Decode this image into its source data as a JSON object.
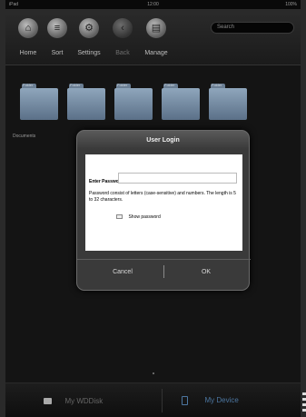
{
  "status_bar": {
    "left": "iPad",
    "center": "12:00",
    "right": "100%"
  },
  "toolbar": {
    "items": [
      {
        "label": "Home",
        "icon": "home-icon",
        "glyph": "⌂"
      },
      {
        "label": "Sort",
        "icon": "sort-icon",
        "glyph": "≡"
      },
      {
        "label": "Settings",
        "icon": "gear-icon",
        "glyph": "⚙"
      },
      {
        "label": "Back",
        "icon": "back-icon",
        "glyph": "‹"
      },
      {
        "label": "Manage",
        "icon": "manage-icon",
        "glyph": "▤"
      }
    ],
    "search_placeholder": "Search"
  },
  "folders": {
    "items": [
      {
        "tab": "Folder"
      },
      {
        "tab": "Folder"
      },
      {
        "tab": "Folder"
      },
      {
        "tab": "Folder"
      },
      {
        "tab": "Folder"
      }
    ],
    "caption": "Documents"
  },
  "dialog": {
    "title": "User Login",
    "password_label": "Enter Password:",
    "password_help": "Password consist of letters (case-sensitive) and numbers. The length is 5 to 32 characters.",
    "show_password_label": "Show password",
    "cancel_label": "Cancel",
    "ok_label": "OK"
  },
  "bottom_bar": {
    "left_tab": "My WDDisk",
    "right_tab": "My Device",
    "active_color": "#4c76a0"
  }
}
